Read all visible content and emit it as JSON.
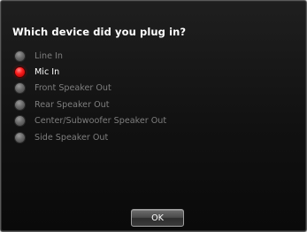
{
  "dialog": {
    "question": "Which device did you plug in?",
    "options": [
      {
        "label": "Line In",
        "selected": false
      },
      {
        "label": "Mic In",
        "selected": true
      },
      {
        "label": "Front Speaker Out",
        "selected": false
      },
      {
        "label": "Rear Speaker Out",
        "selected": false
      },
      {
        "label": "Center/Subwoofer Speaker Out",
        "selected": false
      },
      {
        "label": "Side Speaker Out",
        "selected": false
      }
    ],
    "ok_label": "OK"
  },
  "colors": {
    "background": "#111111",
    "selected_radio": "#ff1e1e",
    "unselected_radio": "#6a6a6a",
    "selected_text": "#ffffff",
    "unselected_text": "#7e7e7e"
  },
  "icons": {
    "selected": "radio-selected-icon",
    "unselected": "radio-unselected-icon"
  }
}
